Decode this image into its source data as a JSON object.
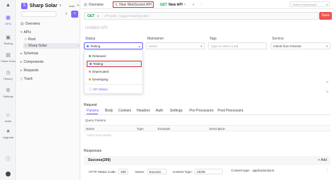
{
  "rail": {
    "items": [
      {
        "label": "APIs",
        "icon": "api-icon"
      },
      {
        "label": "Testing",
        "icon": "testing-icon"
      },
      {
        "label": "Share Docs",
        "icon": "share-docs-icon"
      },
      {
        "label": "History",
        "icon": "history-icon"
      },
      {
        "label": "Settings",
        "icon": "settings-icon"
      },
      {
        "label": "Invite",
        "icon": "invite-icon"
      },
      {
        "label": "Upgrade",
        "icon": "upgrade-icon"
      }
    ]
  },
  "sidebar": {
    "project_name": "Sharp Solar",
    "branch": "main",
    "items": [
      {
        "label": "Overview"
      },
      {
        "label": "APIs"
      },
      {
        "label": "Root"
      },
      {
        "label": "Sharp Solar"
      },
      {
        "label": "Schemas"
      },
      {
        "label": "Components"
      },
      {
        "label": "Requests"
      },
      {
        "label": "Trash"
      }
    ]
  },
  "tabs": {
    "overview": "Overview",
    "new_websocket": "New WebSocket API",
    "new_api_method": "GET",
    "new_api": "New API",
    "environment_placeholder": "Select environment"
  },
  "request": {
    "method": "GET",
    "url_placeholder": "API path , suggest starting with /",
    "save_label": "Save",
    "api_name_placeholder": "Untitled API"
  },
  "fields": {
    "status_label": "Status",
    "status_value": "Testing",
    "maintainer_label": "Maintainer",
    "maintainer_placeholder": "Select",
    "tags_label": "Tags",
    "tags_placeholder": "Type or select a tab",
    "service_label": "Service",
    "service_value": "Inherit from Parents"
  },
  "status_dropdown": {
    "options": [
      {
        "label": "Released",
        "color": "#22c55e"
      },
      {
        "label": "Testing",
        "color": "#3b82f6"
      },
      {
        "label": "Deprecated",
        "color": "#9ca3af"
      },
      {
        "label": "Developing",
        "color": "#f59e0b"
      }
    ],
    "footer": "API Status"
  },
  "request_section": {
    "title": "Request",
    "tabs": [
      "Params",
      "Body",
      "Cookies",
      "Headers",
      "Auth",
      "Settings",
      "Pre Processors",
      "Post Processors"
    ]
  },
  "query_params": {
    "title": "Query Params",
    "columns": [
      "Name",
      "Type",
      "Example",
      "Description"
    ],
    "add_placeholder": "Add a new param"
  },
  "responses": {
    "title": "Responses",
    "current": "Success(200)",
    "add_label": "+ Add",
    "status_code_label": "HTTP Status Code:",
    "status_code_value": "200",
    "name_label": "Name:",
    "name_value": "Success",
    "content_type_label": "Content Type:",
    "content_type_value": "JSON",
    "content_type2_label": "Content-type:",
    "content_type2_value": "application/json"
  },
  "colors": {
    "accent": "#6b5cff",
    "save": "#ef5350",
    "highlight_border": "#d32f2f"
  }
}
